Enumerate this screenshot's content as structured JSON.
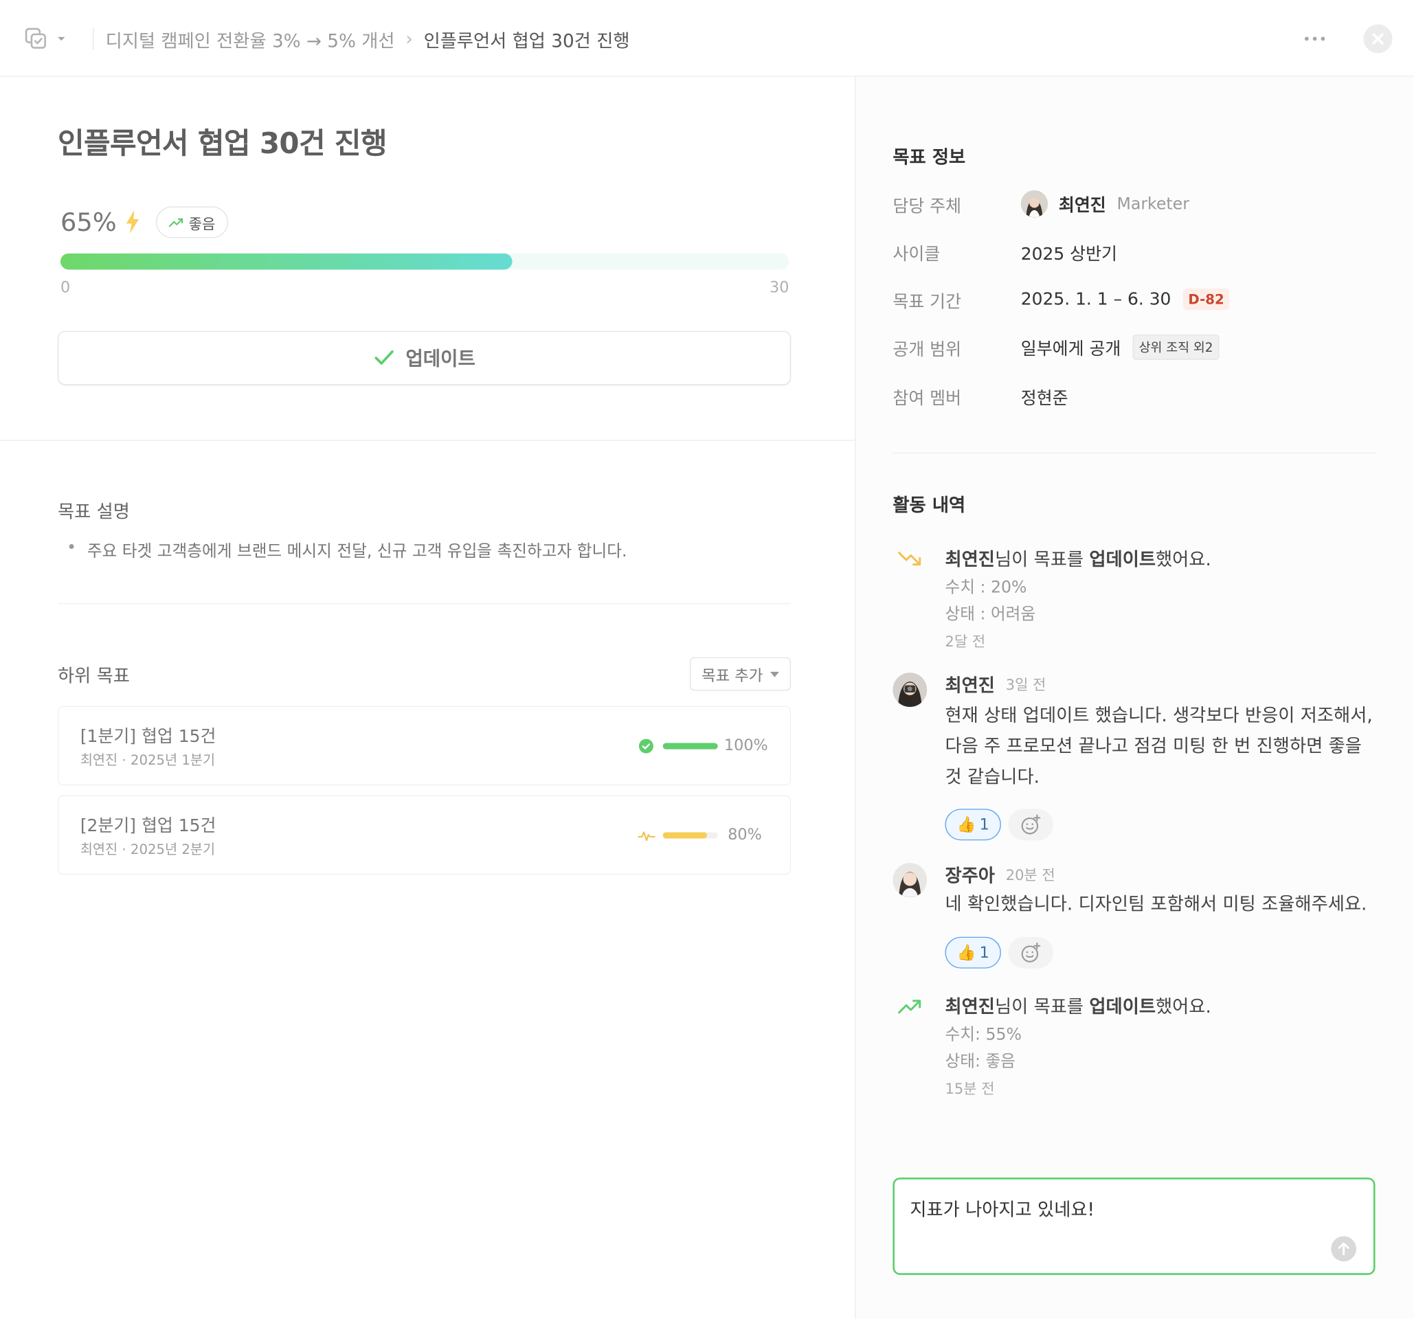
{
  "breadcrumb": {
    "parent": "디지털 캠페인 전환율 3% → 5% 개선",
    "separator": "›",
    "current": "인플루언서 협업 30건 진행"
  },
  "goal": {
    "title": "인플루언서 협업 30건 진행",
    "progress_text": "65%",
    "progress_value": 0.62,
    "status": "좋음",
    "range_min": "0",
    "range_max": "30",
    "update_label": "업데이트"
  },
  "description": {
    "heading": "목표 설명",
    "bullet": "주요 타겟 고객층에게 브랜드 메시지 전달, 신규 고객 유입을 촉진하고자 합니다."
  },
  "subgoals": {
    "heading": "하위 목표",
    "add_label": "목표 추가",
    "items": [
      {
        "title": "[1분기] 협업 15건",
        "meta": "최연진 · 2025년 1분기",
        "percent": "100%",
        "value": 1.0,
        "color": "#5fce6c"
      },
      {
        "title": "[2분기] 협업 15건",
        "meta": "최연진 · 2025년 2분기",
        "percent": "80%",
        "value": 0.8,
        "color": "#f7cd57"
      }
    ]
  },
  "info": {
    "heading": "목표 정보",
    "owner_label": "담당 주체",
    "owner_name": "최연진",
    "owner_role": "Marketer",
    "cycle_label": "사이클",
    "cycle_value": "2025 상반기",
    "period_label": "목표 기간",
    "period_value": "2025. 1. 1 – 6. 30",
    "period_badge": "D-82",
    "scope_label": "공개 범위",
    "scope_value": "일부에게 공개",
    "scope_badge": "상위 조직 외2",
    "members_label": "참여 멤버",
    "members_value": "정현준"
  },
  "activity": {
    "heading": "활동 내역",
    "items": [
      {
        "actor": "최연진",
        "mid": "님이 목표를 ",
        "action": "업데이트",
        "end": "했어요.",
        "line1": "수치 : 20%",
        "line2": "상태 : 어려움",
        "time": "2달 전"
      },
      {
        "author": "최연진",
        "time": "3일 전",
        "text": "현재 상태 업데이트 했습니다. 생각보다 반응이 저조해서, 다음 주 프로모션 끝나고 점검 미팅 한 번 진행하면 좋을 것 같습니다.",
        "reaction_emoji": "👍",
        "reaction_count": "1"
      },
      {
        "author": "장주아",
        "time": "20분 전",
        "text": "네 확인했습니다. 디자인팀 포함해서 미팅 조율해주세요.",
        "reaction_emoji": "👍",
        "reaction_count": "1"
      },
      {
        "actor": "최연진",
        "mid": "님이 목표를 ",
        "action": "업데이트",
        "end": "했어요.",
        "line1": "수치: 55%",
        "line2": "상태: 좋음",
        "time": "15분 전"
      }
    ]
  },
  "comment": {
    "value": "지표가 나아지고 있네요!"
  }
}
